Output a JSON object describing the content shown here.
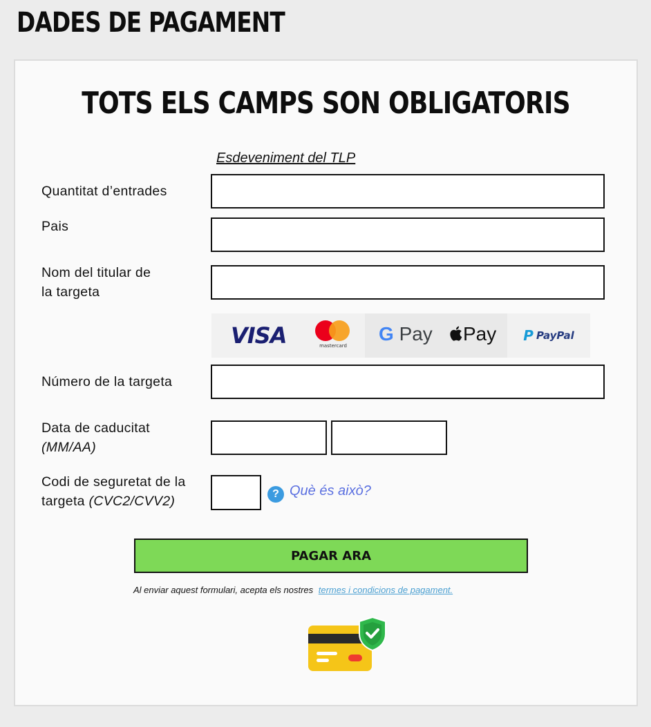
{
  "page_title": "DADES DE PAGAMENT",
  "notice": "TOTS ELS CAMPS SON OBLIGATORIS",
  "event_link": "Esdeveniment del TLP",
  "fields": {
    "quantity_label": "Quantitat d’entrades",
    "country_label": "Pais",
    "holder_label_line1": "Nom del titular de",
    "holder_label_line2": "la targeta",
    "card_number_label": "Número de la targeta",
    "expiry_label": "Data de caducitat",
    "expiry_format": "(MM/AA)",
    "cvc_label_line1": "Codi de seguretat de la",
    "cvc_label_line2": "targeta",
    "cvc_format": "(CVC2/CVV2)"
  },
  "payment_logos": {
    "visa": "VISA",
    "mastercard": "mastercard",
    "gpay_g": "G",
    "gpay": "Pay",
    "applepay": "Pay",
    "paypal": "PayPal"
  },
  "help": {
    "icon": "question-icon",
    "symbol": "?",
    "text": "Què és això?"
  },
  "pay_button": "PAGAR ARA",
  "terms": {
    "text": "Al enviar aquest formulari, acepta els nostres",
    "link": "termes i condicions de pagament."
  },
  "colors": {
    "button": "#7ed957",
    "link": "#4a9fd1",
    "help": "#3b9be0",
    "shield": "#2fb84b",
    "card": "#f5c518"
  }
}
